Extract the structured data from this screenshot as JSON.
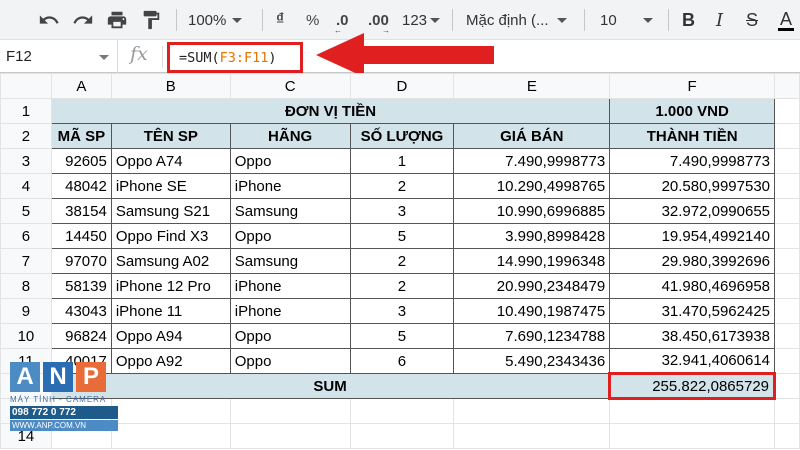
{
  "toolbar": {
    "zoom": "100%",
    "currency": "₫",
    "percent": "%",
    "dec_decrease": ".0",
    "dec_increase": ".00",
    "more_formats": "123",
    "font": "Mặc định (...",
    "font_size": "10",
    "bold": "B",
    "text_color": "A"
  },
  "formula_bar": {
    "cell_ref": "F12",
    "fx": "fx",
    "formula_prefix": "=SUM(",
    "formula_range": "F3:F11",
    "formula_suffix": ")"
  },
  "columns": [
    "A",
    "B",
    "C",
    "D",
    "E",
    "F"
  ],
  "rows": [
    "1",
    "2",
    "3",
    "4",
    "5",
    "6",
    "7",
    "8",
    "9",
    "10",
    "11",
    "12",
    "13",
    "14"
  ],
  "sheet": {
    "title": "ĐƠN VỊ TIỀN",
    "unit": "1.000 VND",
    "headers": [
      "MÃ SP",
      "TÊN SP",
      "HÃNG",
      "SỐ LƯỢNG",
      "GIÁ BÁN",
      "THÀNH TIỀN"
    ],
    "data": [
      [
        "92605",
        "Oppo A74",
        "Oppo",
        "1",
        "7.490,9998773",
        "7.490,9998773"
      ],
      [
        "48042",
        "iPhone SE",
        "iPhone",
        "2",
        "10.290,4998765",
        "20.580,9997530"
      ],
      [
        "38154",
        "Samsung S21",
        "Samsung",
        "3",
        "10.990,6996885",
        "32.972,0990655"
      ],
      [
        "14450",
        "Oppo Find X3",
        "Oppo",
        "5",
        "3.990,8998428",
        "19.954,4992140"
      ],
      [
        "97070",
        "Samsung A02",
        "Samsung",
        "2",
        "14.990,1996348",
        "29.980,3992696"
      ],
      [
        "58139",
        "iPhone 12 Pro",
        "iPhone",
        "2",
        "20.990,2348479",
        "41.980,4696958"
      ],
      [
        "43043",
        "iPhone 11",
        "iPhone",
        "3",
        "10.490,1987475",
        "31.470,5962425"
      ],
      [
        "96824",
        "Oppo A94",
        "Oppo",
        "5",
        "7.690,1234788",
        "38.450,6173938"
      ],
      [
        "40017",
        "Oppo A92",
        "Oppo",
        "6",
        "5.490,2343436",
        "32.941,4060614"
      ]
    ],
    "sum_label": "SUM",
    "sum_value": "255.822,0865729"
  },
  "logo": {
    "letters": [
      "A",
      "N",
      "P"
    ],
    "subtitle": "MÁY TÍNH - CAMERA",
    "phone": "098 772 0 772",
    "website": "WWW.ANP.COM.VN"
  },
  "colors": {
    "header_fill": "#d3e3ea",
    "header_text": "#1f5b8a",
    "highlight": "#e02020",
    "range_ref": "#e37400"
  }
}
